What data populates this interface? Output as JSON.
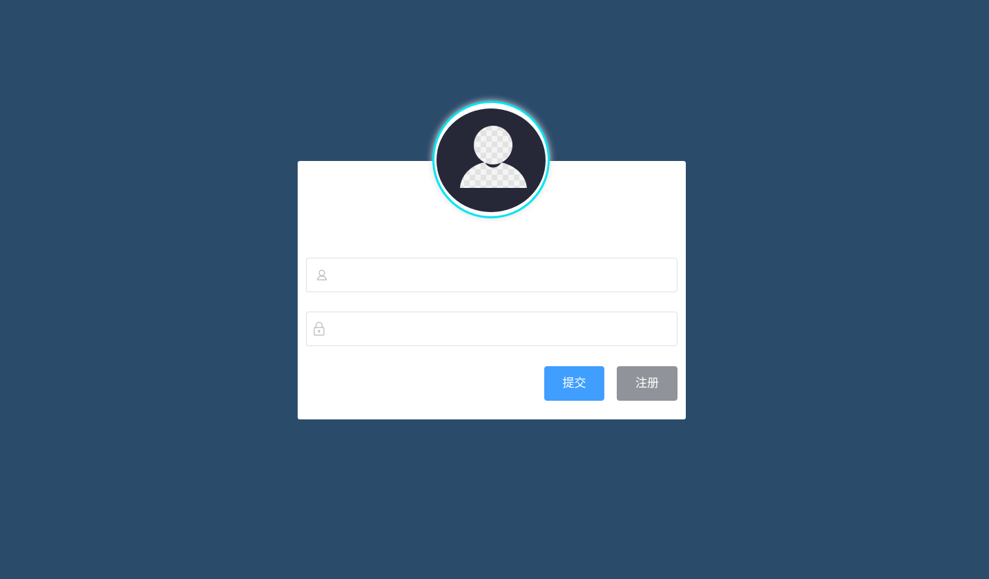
{
  "login": {
    "username": {
      "value": "",
      "placeholder": "",
      "icon": "user-icon"
    },
    "password": {
      "value": "",
      "placeholder": "",
      "icon": "lock-icon"
    },
    "submit_label": "提交",
    "register_label": "注册"
  },
  "avatar": {
    "icon": "avatar-placeholder-icon"
  },
  "colors": {
    "background": "#2b4b6b",
    "card": "#ffffff",
    "avatar_ring": "#00e5f0",
    "avatar_fill": "#262838",
    "primary": "#409eff",
    "info": "#909399"
  }
}
